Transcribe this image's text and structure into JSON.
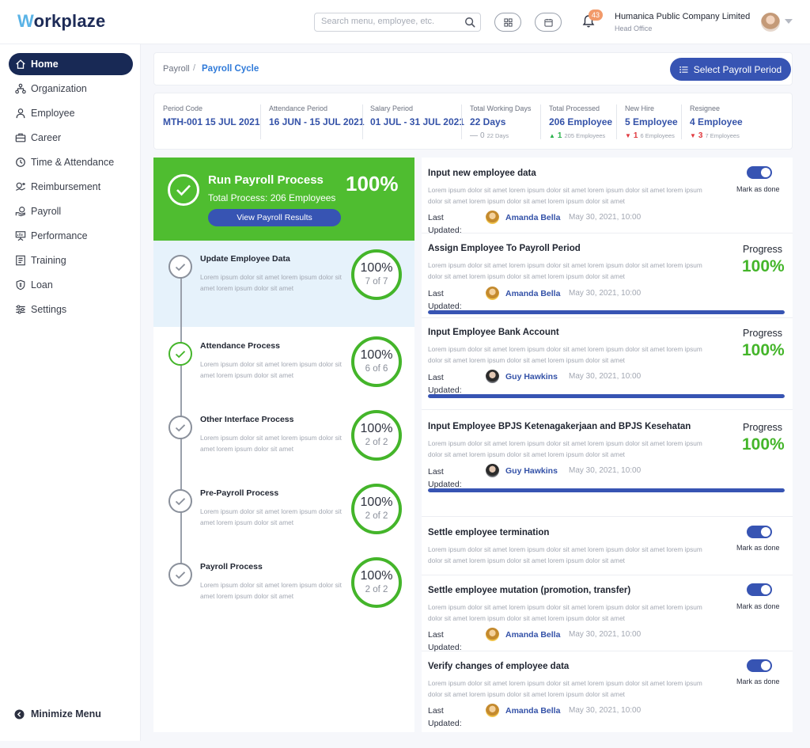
{
  "app": {
    "logo_letter": "W",
    "logo_rest": "orkplaze",
    "search_placeholder": "Search menu, employee, etc.",
    "notification_count": "43",
    "company_name": "Humanica Public Company Limited",
    "company_sub": "Head Office"
  },
  "sidebar": {
    "items": [
      {
        "label": "Home",
        "icon": "home-icon",
        "active": true
      },
      {
        "label": "Organization",
        "icon": "organization-icon"
      },
      {
        "label": "Employee",
        "icon": "user-icon"
      },
      {
        "label": "Career",
        "icon": "briefcase-icon"
      },
      {
        "label": "Time & Attendance",
        "icon": "clock-icon"
      },
      {
        "label": "Reimbursement",
        "icon": "reimbursement-icon"
      },
      {
        "label": "Payroll",
        "icon": "payroll-icon"
      },
      {
        "label": "Performance",
        "icon": "performance-icon"
      },
      {
        "label": "Training",
        "icon": "training-icon"
      },
      {
        "label": "Loan",
        "icon": "loan-icon"
      },
      {
        "label": "Settings",
        "icon": "settings-icon"
      }
    ],
    "minimize_label": "Minimize Menu"
  },
  "breadcrumb": {
    "parent": "Payroll",
    "separator": "/",
    "current": "Payroll Cycle",
    "select_button": "Select Payroll Period"
  },
  "summary": [
    {
      "label": "Period Code",
      "value": "MTH-001 15 JUL 2021"
    },
    {
      "label": "Attendance Period",
      "value": "16 JUN - 15 JUL 2021"
    },
    {
      "label": "Salary Period",
      "value": "01 JUL - 31 JUL 2021"
    },
    {
      "label": "Total Working Days",
      "value": "22 Days",
      "delta_symbol": "—",
      "delta": "0",
      "delta_sub": "22 Days",
      "trend": "flat"
    },
    {
      "label": "Total Processed",
      "value": "206 Employee",
      "delta_symbol": "▲",
      "delta": "1",
      "delta_sub": "205 Employees",
      "trend": "up"
    },
    {
      "label": "New Hire",
      "value": "5 Employee",
      "delta_symbol": "▼",
      "delta": "1",
      "delta_sub": "6 Employees",
      "trend": "down"
    },
    {
      "label": "Resignee",
      "value": "4 Employee",
      "delta_symbol": "▼",
      "delta": "3",
      "delta_sub": "7 Employees",
      "trend": "down"
    }
  ],
  "run": {
    "title": "Run Payroll Process",
    "subtitle": "Total Process: 206 Employees",
    "percent": "100%",
    "button": "View Payroll Results"
  },
  "steps": [
    {
      "title": "Update Employee Data",
      "desc": "Lorem ipsum dolor sit amet lorem ipsum dolor sit amet lorem ipsum dolor sit amet",
      "percent": "100%",
      "count": "7 of 7",
      "state": "highlighted"
    },
    {
      "title": "Attendance Process",
      "desc": "Lorem ipsum dolor sit amet lorem ipsum dolor sit amet lorem ipsum dolor sit amet",
      "percent": "100%",
      "count": "6 of 6",
      "state": "done"
    },
    {
      "title": "Other Interface Process",
      "desc": "Lorem ipsum dolor sit amet lorem ipsum dolor sit amet lorem ipsum dolor sit amet",
      "percent": "100%",
      "count": "2 of 2",
      "state": "pending"
    },
    {
      "title": "Pre-Payroll Process",
      "desc": "Lorem ipsum dolor sit amet lorem ipsum dolor sit amet lorem ipsum dolor sit amet",
      "percent": "100%",
      "count": "2 of 2",
      "state": "pending"
    },
    {
      "title": "Payroll Process",
      "desc": "Lorem ipsum dolor sit amet lorem ipsum dolor sit amet lorem ipsum dolor sit amet",
      "percent": "100%",
      "count": "2 of 2",
      "state": "pending"
    }
  ],
  "labels": {
    "mark_done": "Mark as done",
    "progress": "Progress",
    "last_updated": "Last Updated:"
  },
  "tasks": [
    {
      "title": "Input new employee data",
      "desc": "Lorem ipsum dolor sit amet lorem ipsum dolor sit amet lorem ipsum dolor sit amet lorem ipsum dolor sit amet lorem ipsum dolor sit amet lorem ipsum dolor sit amet",
      "kind": "toggle",
      "done": true,
      "user": "Amanda Bella",
      "avatar": "amanda",
      "date": "May 30, 2021, 10:00"
    },
    {
      "title": "Assign Employee To Payroll Period",
      "desc": "Lorem ipsum dolor sit amet lorem ipsum dolor sit amet lorem ipsum dolor sit amet lorem ipsum dolor sit amet lorem ipsum dolor sit amet lorem ipsum dolor sit amet",
      "kind": "progress",
      "percent": "100%",
      "progress_fraction": 1.0,
      "user": "Amanda Bella",
      "avatar": "amanda",
      "date": "May 30, 2021, 10:00"
    },
    {
      "title": "Input Employee Bank Account",
      "desc": "Lorem ipsum dolor sit amet lorem ipsum dolor sit amet lorem ipsum dolor sit amet lorem ipsum dolor sit amet lorem ipsum dolor sit amet lorem ipsum dolor sit amet",
      "kind": "progress",
      "percent": "100%",
      "progress_fraction": 1.0,
      "user": "Guy Hawkins",
      "avatar": "guy",
      "date": "May 30, 2021, 10:00"
    },
    {
      "title": "Input Employee BPJS Ketenagakerjaan and BPJS Kesehatan",
      "desc": "Lorem ipsum dolor sit amet lorem ipsum dolor sit amet lorem ipsum dolor sit amet lorem ipsum dolor sit amet lorem ipsum dolor sit amet lorem ipsum dolor sit amet",
      "kind": "progress",
      "percent": "100%",
      "progress_fraction": 1.0,
      "user": "Guy Hawkins",
      "avatar": "guy",
      "date": "May 30, 2021, 10:00"
    },
    {
      "title": "Settle employee termination",
      "desc": "Lorem ipsum dolor sit amet lorem ipsum dolor sit amet lorem ipsum dolor sit amet lorem ipsum dolor sit amet lorem ipsum dolor sit amet lorem ipsum dolor sit amet",
      "kind": "toggle",
      "done": true
    },
    {
      "title": "Settle employee mutation (promotion, transfer)",
      "desc": "Lorem ipsum dolor sit amet lorem ipsum dolor sit amet lorem ipsum dolor sit amet lorem ipsum dolor sit amet lorem ipsum dolor sit amet lorem ipsum dolor sit amet",
      "kind": "toggle",
      "done": true,
      "user": "Amanda Bella",
      "avatar": "amanda",
      "date": "May 30, 2021, 10:00"
    },
    {
      "title": "Verify changes of employee data",
      "desc": "Lorem ipsum dolor sit amet lorem ipsum dolor sit amet lorem ipsum dolor sit amet lorem ipsum dolor sit amet lorem ipsum dolor sit amet lorem ipsum dolor sit amet",
      "kind": "toggle",
      "done": true,
      "user": "Amanda Bella",
      "avatar": "amanda",
      "date": "May 30, 2021, 10:00"
    }
  ],
  "colors": {
    "primary": "#3754b3",
    "nav_active": "#182955",
    "success": "#44b52a",
    "run_bg": "#4fbd30",
    "highlight": "#e6f2fb",
    "up": "#2bb24c",
    "down": "#e0383e"
  }
}
